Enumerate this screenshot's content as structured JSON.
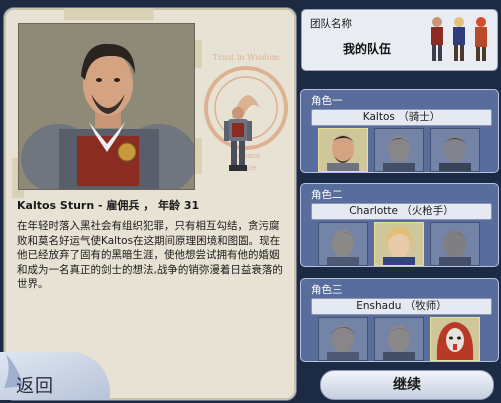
{
  "hero": {
    "name_line": "Kaltos Sturn - 雇佣兵 ， 年龄 31",
    "bio": "在年轻时落入黑社会有组织犯罪，只有相互勾结，贪污腐败和莫名好运气使Kaltos在这期间原理困境和图圄。现在他已经放弃了固有的黑暗生涯，使他想尝试拥有他的婚姻和成为一名真正的剑士的想法,战争的销弥漫着日益衰落的世界。",
    "emblem_text": [
      "Trust in Wisdom",
      "Balance",
      "Peace"
    ]
  },
  "nav": {
    "back_label": "返回"
  },
  "team": {
    "label": "团队名称",
    "name": "我的队伍"
  },
  "slots": [
    {
      "title": "角色一",
      "name": "Kaltos （骑士）"
    },
    {
      "title": "角色二",
      "name": "Charlotte （火枪手）"
    },
    {
      "title": "角色三",
      "name": "Enshadu （牧师）"
    }
  ],
  "continue_label": "继续",
  "colors": {
    "panel": "#e7e2d4",
    "slot": "#586d9b",
    "selected": "#cfc79a"
  }
}
